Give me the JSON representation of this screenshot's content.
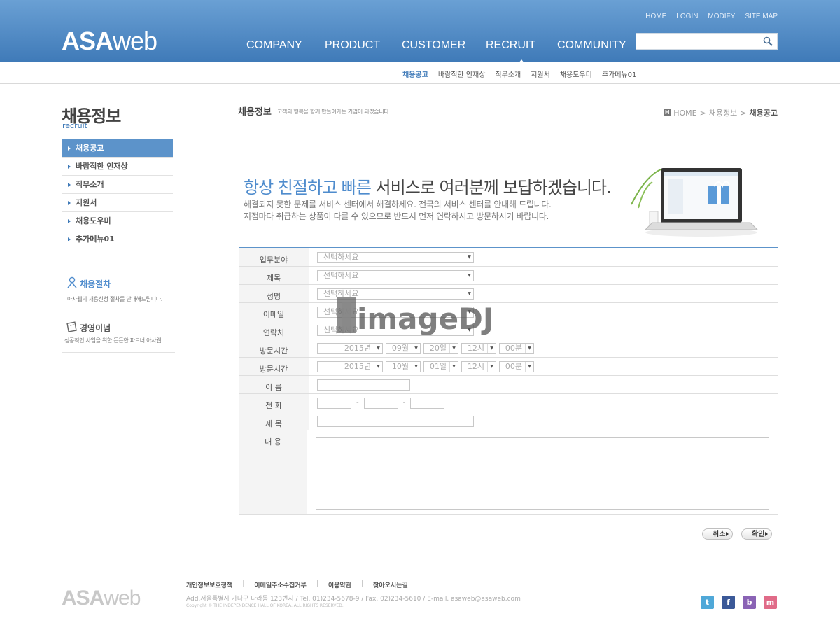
{
  "header": {
    "logo_bold": "ASA",
    "logo_thin": "web",
    "util_links": [
      "HOME",
      "LOGIN",
      "MODIFY",
      "SITE MAP"
    ],
    "gnb": [
      "COMPANY",
      "PRODUCT",
      "CUSTOMER",
      "RECRUIT",
      "COMMUNITY"
    ],
    "active_gnb": "RECRUIT",
    "search_placeholder": ""
  },
  "subnav": [
    "채용공고",
    "바람직한 인재상",
    "직무소개",
    "지원서",
    "채용도우미",
    "추가메뉴01"
  ],
  "sidebar": {
    "title": "채용정보",
    "subtitle": "recruit",
    "items": [
      "채용공고",
      "바람직한 인재상",
      "직무소개",
      "지원서",
      "채용도우미",
      "추가메뉴01"
    ],
    "box1_title": "채용절차",
    "box1_desc": "아사웹의 채용신청 절차를 안내해드립니다.",
    "box2_title": "경영이념",
    "box2_desc": "성공적인 사업을 위한 든든한 파트너 아사웹."
  },
  "content": {
    "title": "채용정보",
    "desc": "고객의 행복을 함께 만들어가는 기업이 되겠습니다.",
    "breadcrumb": [
      "HOME",
      "채용정보",
      "채용공고"
    ],
    "hero_highlight": "항상 친절하고 빠른",
    "hero_rest": "서비스로 여러분께 보답하겠습니다.",
    "hero_line1": "해결되지 못한 문제를 서비스 센터에서 해결하세요. 전국의 서비스 센터를 안내해 드립니다.",
    "hero_line2": "지점마다 취급하는 상품이 다를 수 있으므로 반드시 먼저 연락하시고 방문하시기 바랍니다."
  },
  "form": {
    "labels": [
      "업무분야",
      "제목",
      "성명",
      "이메일",
      "연락처",
      "방문시간",
      "방문시간",
      "이 름",
      "전 화",
      "제 목",
      "내 용"
    ],
    "select_placeholder": "선택하세요",
    "visit1": [
      "2015년",
      "09월",
      "20일",
      "12시",
      "00분"
    ],
    "visit2": [
      "2015년",
      "10월",
      "01일",
      "12시",
      "00분"
    ],
    "phone_dash": "-",
    "cancel": "취소",
    "confirm": "확인"
  },
  "watermark": "imageDJ",
  "footer": {
    "logo_bold": "ASA",
    "logo_thin": "web",
    "links": [
      "개인정보보호정책",
      "이메일주소수집거부",
      "이용약관",
      "찾아오시는길"
    ],
    "sep": "|",
    "address": "Add.서울특별시 가나구 다라동 123번지  /  Tel. 01)234-5678-9  /  Fax. 02)234-5610  /          E-mail. asaweb@asaweb.com",
    "copyright": "Copyright © THE INDEPENDENCE HALL OF KOREA. ALL RIGHTS RESERVED.",
    "sns": [
      "twitter-icon",
      "facebook-icon",
      "blog-icon",
      "me2day-icon"
    ]
  },
  "colors": {
    "header_top": "#6aa0d4",
    "header_bottom": "#3f7ab8",
    "accent": "#5c93ca",
    "hero_highlight": "#4f8ccd"
  }
}
